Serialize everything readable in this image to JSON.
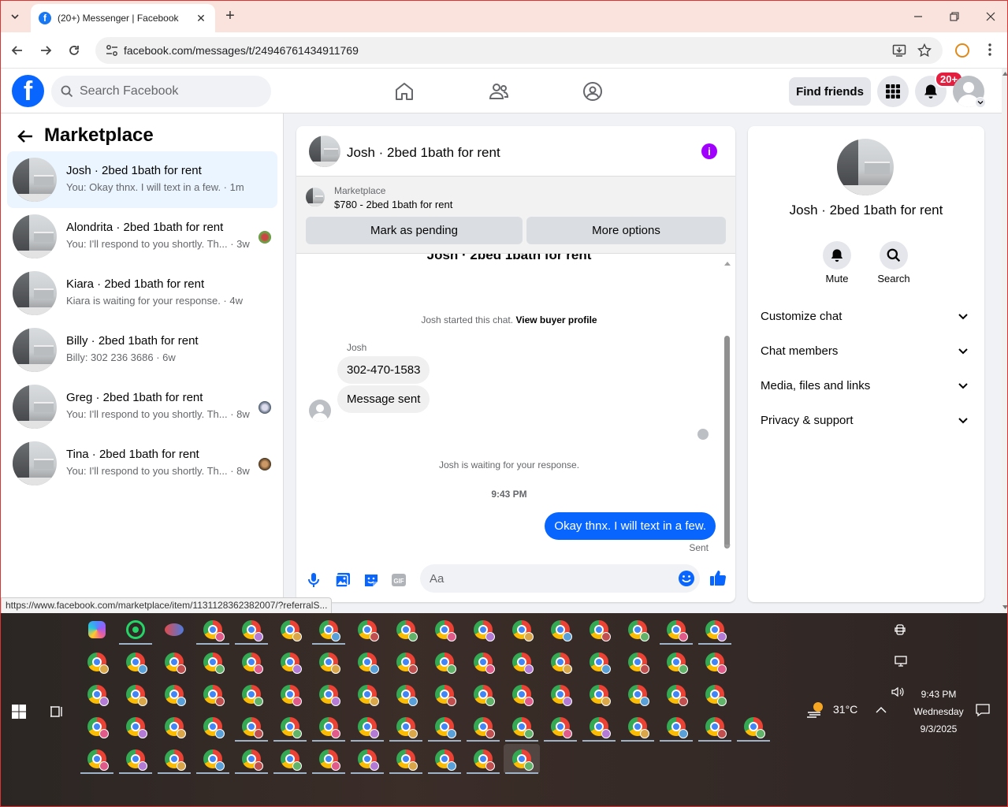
{
  "browser": {
    "tab_title": "(20+) Messenger | Facebook",
    "url": "facebook.com/messages/t/24946761434911769",
    "status_url": "https://www.facebook.com/marketplace/item/1131128362382007/?referralS..."
  },
  "fb_header": {
    "search_placeholder": "Search Facebook",
    "find_friends": "Find friends",
    "notif_badge": "20+",
    "brand_color": "#0866ff"
  },
  "sidebar": {
    "title": "Marketplace",
    "conversations": [
      {
        "name": "Josh · 2bed 1bath for rent",
        "preview": "You: Okay thnx. I will text in a few. · 1m",
        "active": true
      },
      {
        "name": "Alondrita · 2bed 1bath for rent",
        "preview": "You: I'll respond to you shortly. Th... · 3w",
        "active": false
      },
      {
        "name": "Kiara · 2bed 1bath for rent",
        "preview": "Kiara is waiting for your response. · 4w",
        "active": false
      },
      {
        "name": "Billy · 2bed 1bath for rent",
        "preview": "Billy: 302 236 3686 · 6w",
        "active": false
      },
      {
        "name": "Greg · 2bed 1bath for rent",
        "preview": "You: I'll respond to you shortly. Th... · 8w",
        "active": false
      },
      {
        "name": "Tina · 2bed 1bath for rent",
        "preview": "You: I'll respond to you shortly. Th... · 8w",
        "active": false
      }
    ]
  },
  "chat": {
    "title": "Josh · 2bed 1bath for rent",
    "marketplace_label": "Marketplace",
    "marketplace_item": "$780 - 2bed 1bath for rent",
    "mark_pending": "Mark as pending",
    "more_options": "More options",
    "scrolled_title": "Josh · 2bed 1bath for rent",
    "started_text": "Josh started this chat.",
    "view_profile": "View buyer profile",
    "sender_name": "Josh",
    "messages_in": [
      "302-470-1583",
      "Message sent"
    ],
    "waiting": "Josh is waiting for your response.",
    "timestamp": "9:43 PM",
    "message_out": "Okay thnx. I will text in a few.",
    "sent_status": "Sent",
    "input_placeholder": "Aa"
  },
  "info_panel": {
    "name": "Josh · 2bed 1bath for rent",
    "mute": "Mute",
    "search": "Search",
    "sections": [
      "Customize chat",
      "Chat members",
      "Media, files and links",
      "Privacy & support"
    ]
  },
  "taskbar": {
    "temperature": "31°C",
    "time": "9:43 PM",
    "day": "Wednesday",
    "date": "9/3/2025"
  }
}
